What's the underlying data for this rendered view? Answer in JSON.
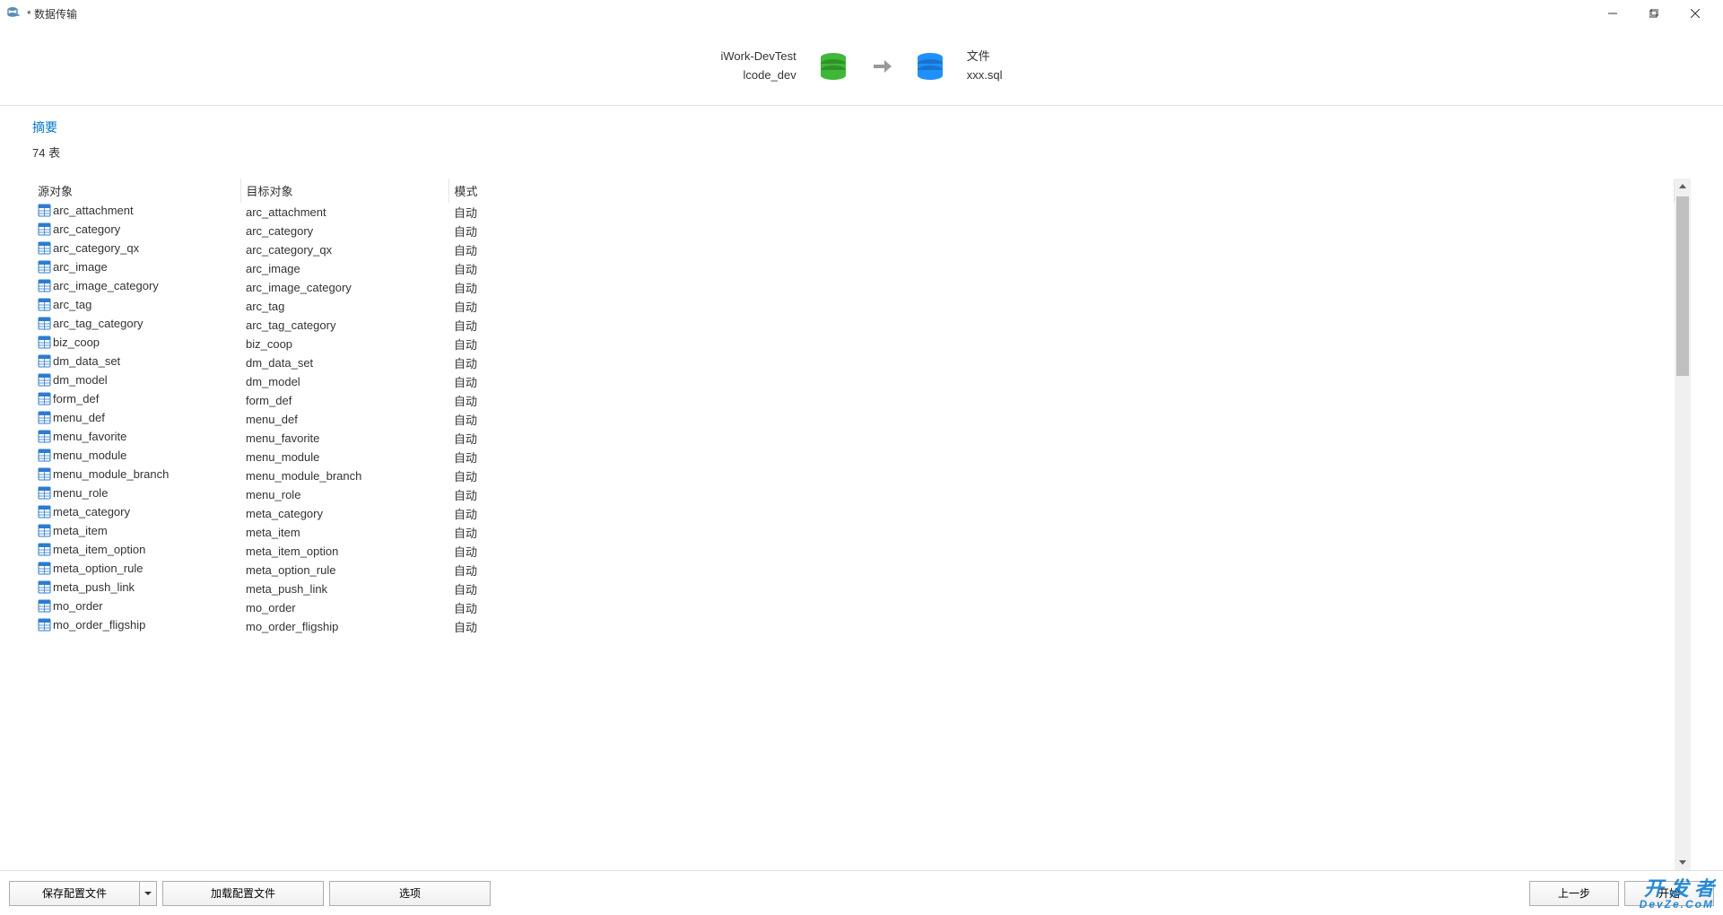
{
  "window": {
    "title": "* 数据传输"
  },
  "flow": {
    "source_name": "iWork-DevTest",
    "source_db": "lcode_dev",
    "target_label": "文件",
    "target_file": "xxx.sql"
  },
  "summary": {
    "title": "摘要",
    "count_text": "74 表"
  },
  "columns": {
    "source": "源对象",
    "target": "目标对象",
    "mode": "模式"
  },
  "mode_value": "自动",
  "rows": [
    {
      "s": "arc_attachment",
      "t": "arc_attachment"
    },
    {
      "s": "arc_category",
      "t": "arc_category"
    },
    {
      "s": "arc_category_qx",
      "t": "arc_category_qx"
    },
    {
      "s": "arc_image",
      "t": "arc_image"
    },
    {
      "s": "arc_image_category",
      "t": "arc_image_category"
    },
    {
      "s": "arc_tag",
      "t": "arc_tag"
    },
    {
      "s": "arc_tag_category",
      "t": "arc_tag_category"
    },
    {
      "s": "biz_coop",
      "t": "biz_coop"
    },
    {
      "s": "dm_data_set",
      "t": "dm_data_set"
    },
    {
      "s": "dm_model",
      "t": "dm_model"
    },
    {
      "s": "form_def",
      "t": "form_def"
    },
    {
      "s": "menu_def",
      "t": "menu_def"
    },
    {
      "s": "menu_favorite",
      "t": "menu_favorite"
    },
    {
      "s": "menu_module",
      "t": "menu_module"
    },
    {
      "s": "menu_module_branch",
      "t": "menu_module_branch"
    },
    {
      "s": "menu_role",
      "t": "menu_role"
    },
    {
      "s": "meta_category",
      "t": "meta_category"
    },
    {
      "s": "meta_item",
      "t": "meta_item"
    },
    {
      "s": "meta_item_option",
      "t": "meta_item_option"
    },
    {
      "s": "meta_option_rule",
      "t": "meta_option_rule"
    },
    {
      "s": "meta_push_link",
      "t": "meta_push_link"
    },
    {
      "s": "mo_order",
      "t": "mo_order"
    },
    {
      "s": "mo_order_fligship",
      "t": "mo_order_fligship"
    }
  ],
  "footer": {
    "save_profile": "保存配置文件",
    "load_profile": "加载配置文件",
    "options": "选项",
    "prev": "上一步",
    "start": "开始"
  },
  "watermark": {
    "line1": "开 发 者",
    "line2": "DevZe.CoM"
  }
}
